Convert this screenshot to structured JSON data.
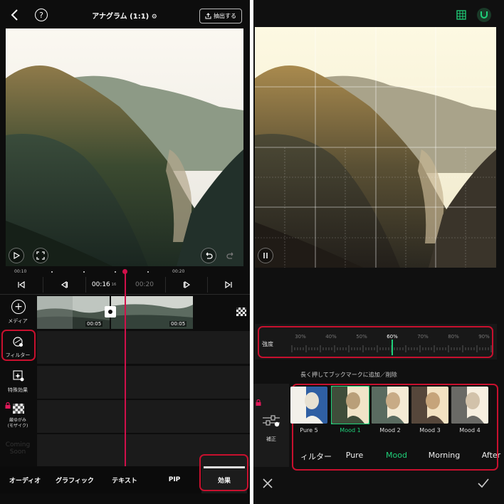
{
  "left_panel": {
    "header": {
      "back_icon": "chevron-left-icon",
      "help_icon": "question-circle-icon",
      "title": "アナグラム (1:1)",
      "settings_icon": "gear-icon",
      "export_label": "抽出する"
    },
    "preview": {
      "play_icon": "play-icon",
      "fullscreen_icon": "fullscreen-icon",
      "undo_icon": "undo-icon",
      "redo_icon": "redo-icon"
    },
    "ruler": {
      "ticks": [
        "00:10",
        "00:20"
      ]
    },
    "controls": {
      "current_time": "00:16",
      "time_suffix": "16",
      "next_time": "00:20"
    },
    "tracks": {
      "media_label": "メディア",
      "clip_durations": [
        "00:05",
        "00:05"
      ],
      "filter_label": "フィルター",
      "special_effects_label": "特殊効果",
      "mosaic_label": "厳ゆがみ\n(モザイク)",
      "coming_soon_label": "Coming Soon"
    },
    "tabs": [
      "オーディオ",
      "グラフィック",
      "テキスト",
      "PIP",
      "効果"
    ],
    "active_tab": "効果"
  },
  "right_panel": {
    "top_icons": [
      "grid-icon",
      "magnet-icon"
    ],
    "pause_icon": "pause-icon",
    "intensity": {
      "label": "強度",
      "percents": [
        "30%",
        "40%",
        "50%",
        "60%",
        "70%",
        "80%",
        "90%"
      ],
      "selected": "60%",
      "value_percent": 60
    },
    "bookmark_hint": "長く押してブックマークに追加／削除",
    "adjust_label": "補正",
    "filters": [
      {
        "name": "Pure 5",
        "display": "Pure 5"
      },
      {
        "name": "Mood 1",
        "display": "Mood 1"
      },
      {
        "name": "Mood 2",
        "display": "Mood 2"
      },
      {
        "name": "Mood 3",
        "display": "Mood 3"
      },
      {
        "name": "Mood 4",
        "display": "Mood 4"
      }
    ],
    "selected_filter": "Mood 1",
    "categories": [
      "ィルター",
      "Pure",
      "Mood",
      "Morning",
      "After"
    ],
    "selected_category": "Mood",
    "cancel_icon": "close-icon",
    "confirm_icon": "check-icon"
  },
  "colors": {
    "accent": "#1fd17a",
    "highlight_red": "#c8102e",
    "playhead": "#d0104a"
  }
}
